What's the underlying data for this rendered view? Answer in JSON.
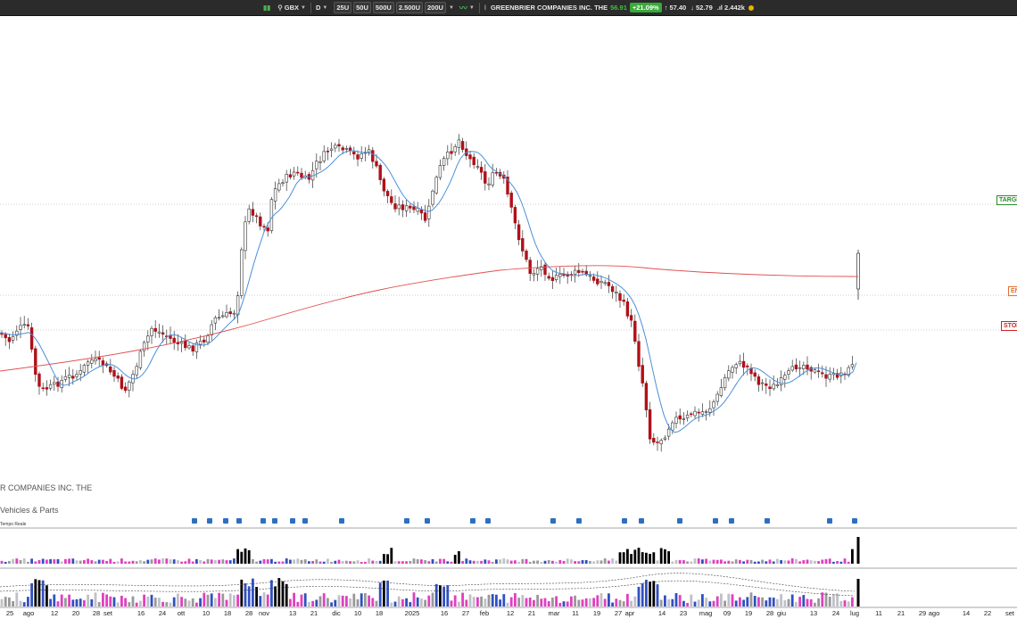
{
  "toolbar": {
    "symbol": "GBX",
    "period": "D",
    "ma_buttons": [
      "25U",
      "50U",
      "500U",
      "2.500U",
      "200U"
    ],
    "company": "GREENBRIER COMPANIES INC. THE",
    "last_price": "56.91",
    "change": "+21.09%",
    "high": "57.40",
    "low": "52.79",
    "volume": "2.442k"
  },
  "labels": {
    "target": "TARGET",
    "entry": "EN",
    "stop": "STOP"
  },
  "company_name": "R COMPANIES INC. THE",
  "sector": "Vehicles & Parts",
  "tempo_reale": "Tempo Reale",
  "x_ticks": [
    {
      "label": "25",
      "x": 11
    },
    {
      "label": "ago",
      "x": 32
    },
    {
      "label": "12",
      "x": 61
    },
    {
      "label": "20",
      "x": 85
    },
    {
      "label": "28",
      "x": 108
    },
    {
      "label": "set",
      "x": 121
    },
    {
      "label": "16",
      "x": 158
    },
    {
      "label": "24",
      "x": 182
    },
    {
      "label": "ott",
      "x": 203
    },
    {
      "label": "10",
      "x": 231
    },
    {
      "label": "18",
      "x": 255
    },
    {
      "label": "28",
      "x": 279
    },
    {
      "label": "nov",
      "x": 296
    },
    {
      "label": "13",
      "x": 328
    },
    {
      "label": "21",
      "x": 352
    },
    {
      "label": "dic",
      "x": 377
    },
    {
      "label": "10",
      "x": 401
    },
    {
      "label": "18",
      "x": 425
    },
    {
      "label": "2025",
      "x": 462
    },
    {
      "label": "16",
      "x": 498
    },
    {
      "label": "27",
      "x": 522
    },
    {
      "label": "feb",
      "x": 543
    },
    {
      "label": "12",
      "x": 572
    },
    {
      "label": "21",
      "x": 596
    },
    {
      "label": "mar",
      "x": 621
    },
    {
      "label": "11",
      "x": 645
    },
    {
      "label": "19",
      "x": 669
    },
    {
      "label": "27",
      "x": 693
    },
    {
      "label": "apr",
      "x": 706
    },
    {
      "label": "14",
      "x": 742
    },
    {
      "label": "23",
      "x": 766
    },
    {
      "label": "mag",
      "x": 791
    },
    {
      "label": "09",
      "x": 815
    },
    {
      "label": "19",
      "x": 839
    },
    {
      "label": "28",
      "x": 863
    },
    {
      "label": "giu",
      "x": 876
    },
    {
      "label": "13",
      "x": 912
    },
    {
      "label": "24",
      "x": 937
    },
    {
      "label": "lug",
      "x": 958
    },
    {
      "label": "11",
      "x": 985
    },
    {
      "label": "21",
      "x": 1010
    },
    {
      "label": "29",
      "x": 1034
    },
    {
      "label": "ago",
      "x": 1047
    },
    {
      "label": "14",
      "x": 1083
    },
    {
      "label": "22",
      "x": 1107
    },
    {
      "label": "set",
      "x": 1132
    }
  ],
  "colors": {
    "up": "#ffffff",
    "down": "#b01018",
    "ma_fast": "#4a90d9",
    "ma_slow": "#e05050",
    "target": "#2a8a2a",
    "entry": "#e07030",
    "stop": "#d02020"
  }
}
